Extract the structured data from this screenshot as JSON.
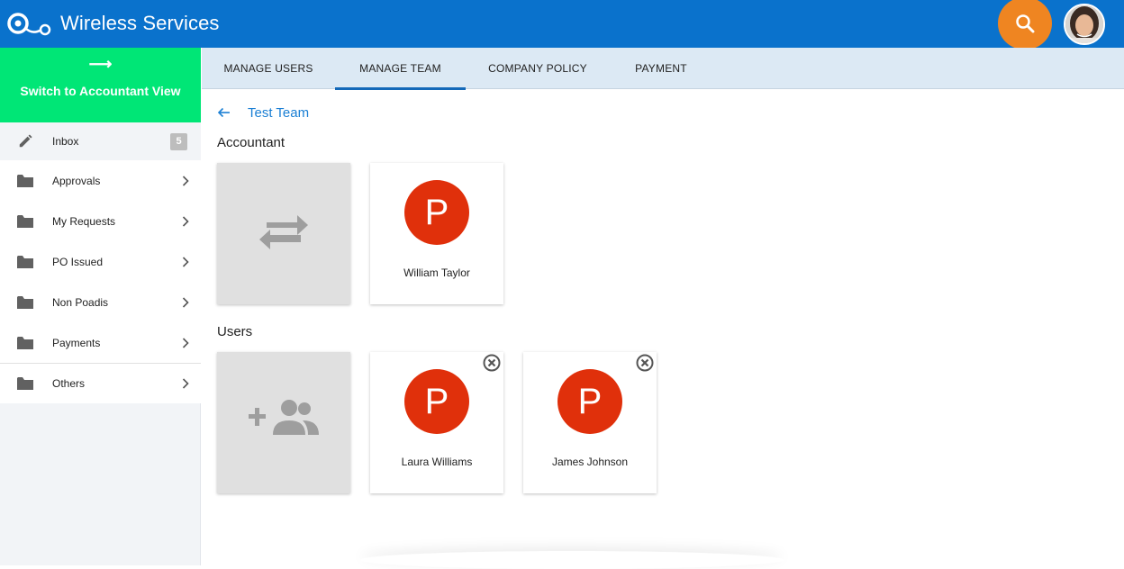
{
  "header": {
    "app_title": "Wireless Services",
    "logo_icon": "app-logo-icon",
    "search_icon": "search-icon",
    "accent_color": "#0a72cc",
    "search_color": "#ef8521"
  },
  "sidebar": {
    "switch_arrow": "⟶",
    "switch_label": "Switch to Accountant View",
    "switch_color": "#00e676",
    "items": [
      {
        "label": "Inbox",
        "icon": "pencil-icon",
        "badge": "5"
      },
      {
        "label": "Approvals",
        "icon": "folder-icon"
      },
      {
        "label": "My Requests",
        "icon": "folder-icon"
      },
      {
        "label": "PO Issued",
        "icon": "folder-icon"
      },
      {
        "label": "Non Poadis",
        "icon": "folder-icon"
      },
      {
        "label": "Payments",
        "icon": "folder-icon"
      },
      {
        "label": "Others",
        "icon": "folder-icon"
      }
    ]
  },
  "tabs": [
    {
      "label": "MANAGE USERS",
      "active": false
    },
    {
      "label": "MANAGE TEAM",
      "active": true
    },
    {
      "label": "COMPANY POLICY",
      "active": false
    },
    {
      "label": "PAYMENT",
      "active": false
    }
  ],
  "team": {
    "name": "Test Team",
    "back_icon": "arrow-left-icon"
  },
  "accountant": {
    "title": "Accountant",
    "swap_icon": "swap-arrows-icon",
    "members": [
      {
        "initial": "P",
        "name": "William Taylor"
      }
    ]
  },
  "users": {
    "title": "Users",
    "add_icon": "add-group-icon",
    "members": [
      {
        "initial": "P",
        "name": "Laura Williams",
        "remove_icon": "close-circle-icon"
      },
      {
        "initial": "P",
        "name": "James Johnson",
        "remove_icon": "close-circle-icon"
      }
    ]
  },
  "colors": {
    "avatar": "#e0300b",
    "link": "#1a7fd4",
    "tab_indicator": "#1469b8"
  }
}
